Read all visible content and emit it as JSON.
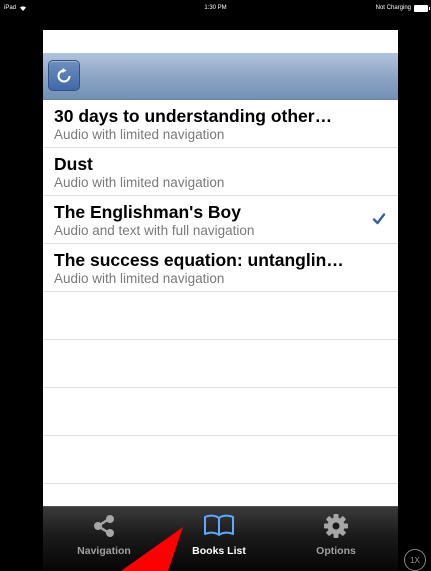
{
  "status_bar": {
    "device": "iPad",
    "time": "1:30 PM",
    "battery_status": "Not Charging"
  },
  "toolbar": {
    "refresh_icon": "refresh-icon"
  },
  "books": [
    {
      "title": "30 days to understanding other…",
      "subtitle": "Audio with limited navigation",
      "selected": false
    },
    {
      "title": "Dust",
      "subtitle": "Audio with limited navigation",
      "selected": false
    },
    {
      "title": "The Englishman's Boy",
      "subtitle": "Audio and text with full navigation",
      "selected": true
    },
    {
      "title": "The success equation: untanglin…",
      "subtitle": "Audio with limited navigation",
      "selected": false
    }
  ],
  "tabs": [
    {
      "label": "Navigation",
      "icon": "share-icon",
      "active": false
    },
    {
      "label": "Books List",
      "icon": "book-icon",
      "active": true
    },
    {
      "label": "Options",
      "icon": "gear-icon",
      "active": false
    }
  ],
  "zoom_badge": "1X",
  "colors": {
    "accent": "#3f69a6",
    "checkmark": "#3b5f9a",
    "annotation_arrow": "#ff0000"
  }
}
